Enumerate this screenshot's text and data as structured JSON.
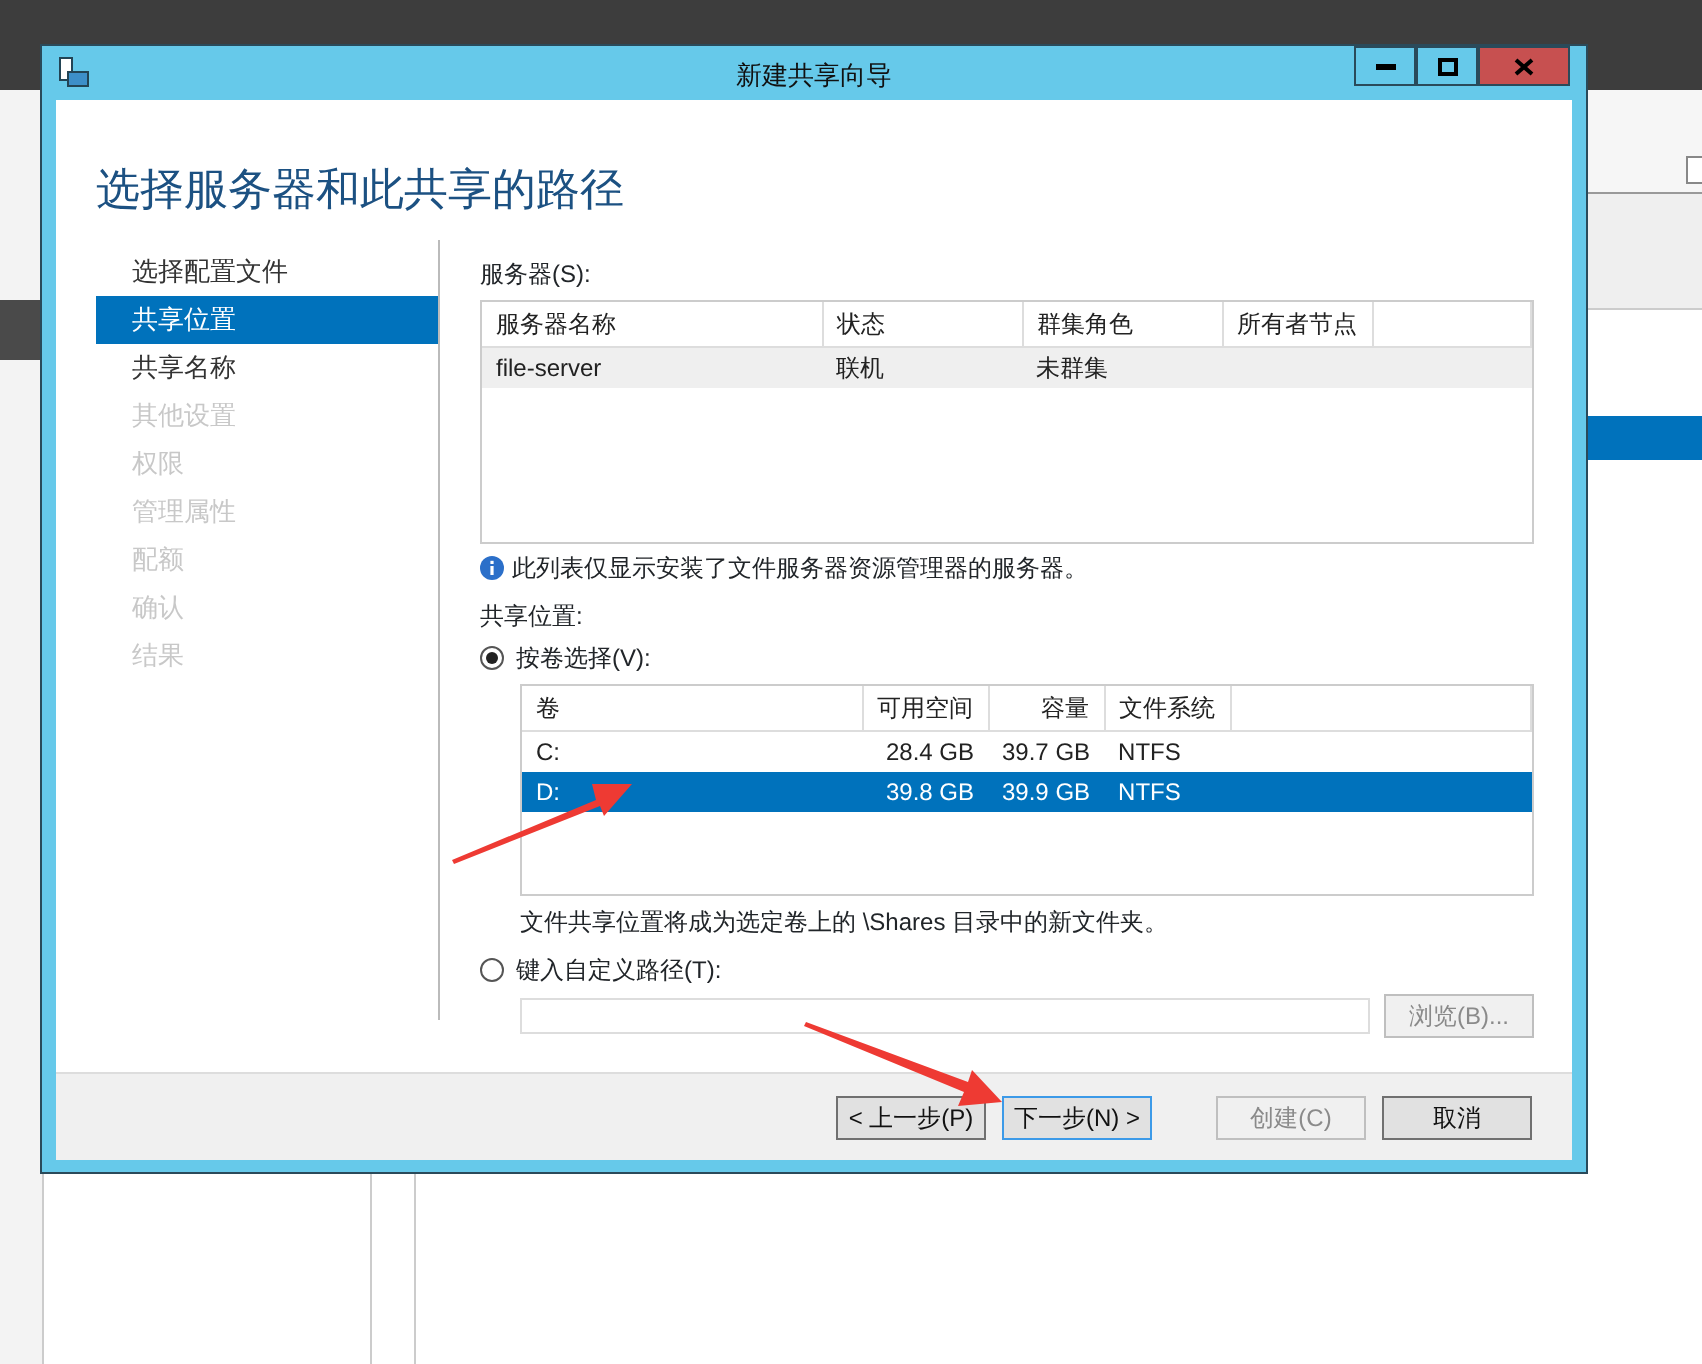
{
  "background": {
    "checkbox": {
      "checked": false
    }
  },
  "window": {
    "title": "新建共享向导"
  },
  "heading": "选择服务器和此共享的路径",
  "steps": [
    {
      "label": "选择配置文件",
      "selected": false,
      "disabled": false
    },
    {
      "label": "共享位置",
      "selected": true,
      "disabled": false
    },
    {
      "label": "共享名称",
      "selected": false,
      "disabled": false
    },
    {
      "label": "其他设置",
      "selected": false,
      "disabled": true
    },
    {
      "label": "权限",
      "selected": false,
      "disabled": true
    },
    {
      "label": "管理属性",
      "selected": false,
      "disabled": true
    },
    {
      "label": "配额",
      "selected": false,
      "disabled": true
    },
    {
      "label": "确认",
      "selected": false,
      "disabled": true
    },
    {
      "label": "结果",
      "selected": false,
      "disabled": true
    }
  ],
  "servers": {
    "label": "服务器(S):",
    "focused": false,
    "columns": [
      "服务器名称",
      "状态",
      "群集角色",
      "所有者节点"
    ],
    "rows": [
      {
        "cells": [
          "file-server",
          "联机",
          "未群集",
          ""
        ],
        "selected": true
      }
    ],
    "note": "此列表仅显示安装了文件服务器资源管理器的服务器。"
  },
  "share_location": {
    "label": "共享位置:",
    "by_volume": {
      "label": "按卷选择(V):",
      "selected": true
    },
    "volumes": {
      "focused": true,
      "columns": [
        "卷",
        "可用空间",
        "容量",
        "文件系统"
      ],
      "rows": [
        {
          "cells": [
            "C:",
            "28.4 GB",
            "39.7 GB",
            "NTFS"
          ],
          "selected": false
        },
        {
          "cells": [
            "D:",
            "39.8 GB",
            "39.9 GB",
            "NTFS"
          ],
          "selected": true
        }
      ],
      "note": "文件共享位置将成为选定卷上的 \\Shares 目录中的新文件夹。"
    },
    "custom_path": {
      "label": "键入自定义路径(T):",
      "selected": false
    },
    "browse_button": {
      "label": "浏览(B)...",
      "disabled": true
    }
  },
  "buttons": [
    {
      "label": "< 上一步(P)",
      "disabled": false,
      "default": false
    },
    {
      "label": "下一步(N) >",
      "disabled": false,
      "default": true
    },
    {
      "label": "创建(C)",
      "disabled": true,
      "default": false
    },
    {
      "label": "取消",
      "disabled": false,
      "default": false
    }
  ]
}
